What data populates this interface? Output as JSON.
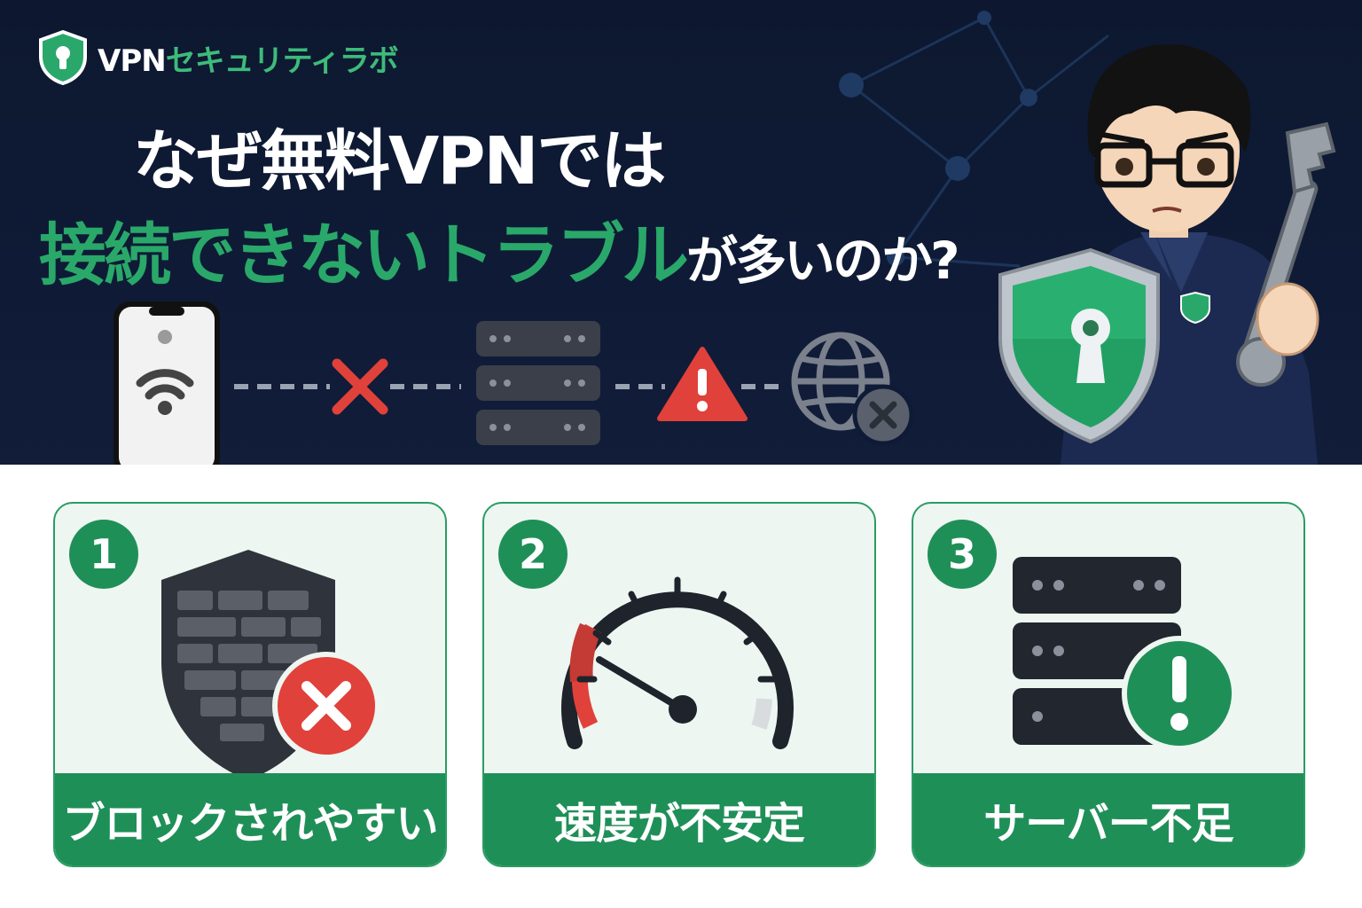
{
  "brand": {
    "vpn": "VPN",
    "name": "セキュリティラボ"
  },
  "headline": {
    "line1": "なぜ無料VPNでは",
    "line2_highlight": "接続できないトラブル",
    "line2_rest": "が多いのか?"
  },
  "cards": [
    {
      "number": "1",
      "label": "ブロックされやすい",
      "icon": "shield-firewall-x-icon"
    },
    {
      "number": "2",
      "label": "速度が不安定",
      "icon": "speedometer-icon"
    },
    {
      "number": "3",
      "label": "サーバー不足",
      "icon": "server-alert-icon"
    }
  ],
  "colors": {
    "hero_bg": "#0d1830",
    "green": "#1f8f58",
    "green_light": "#3dbb7a",
    "red": "#e0413a",
    "card_bg": "#eef6f1"
  }
}
